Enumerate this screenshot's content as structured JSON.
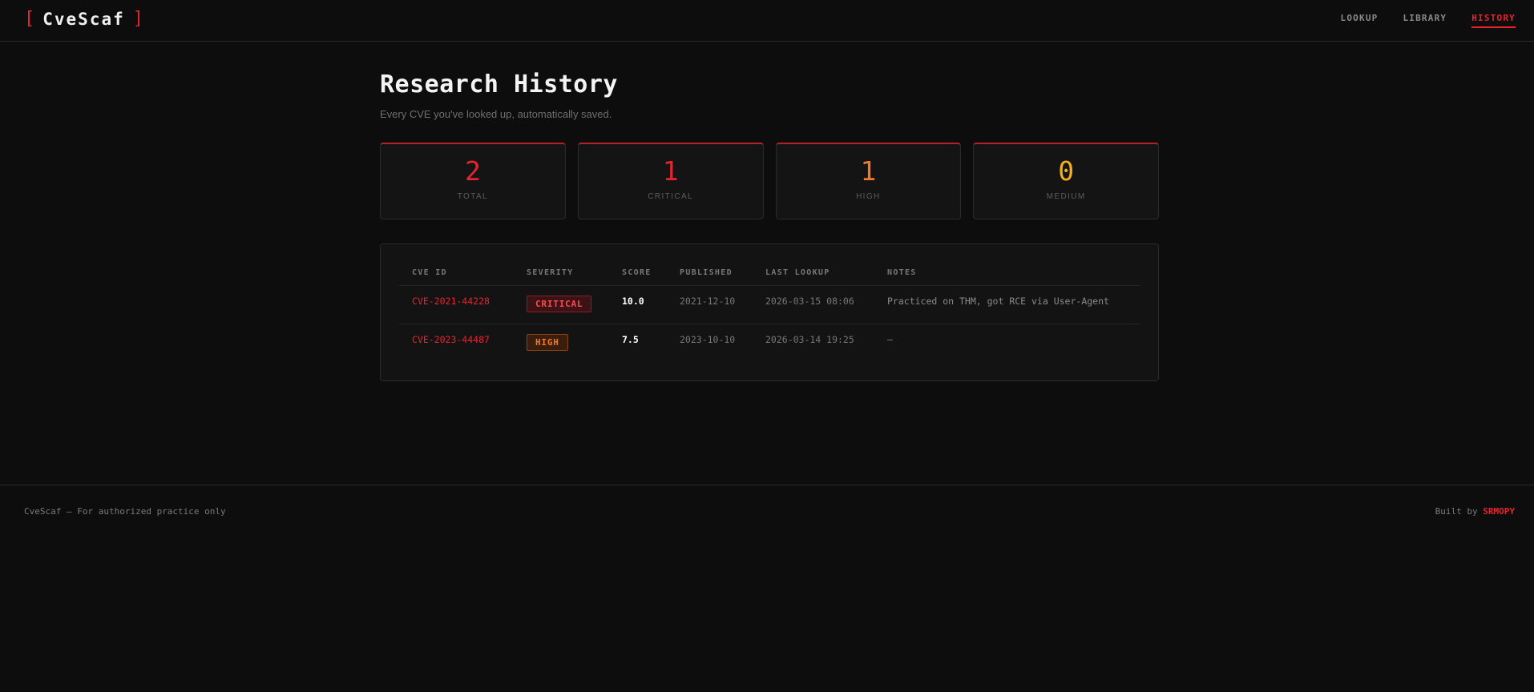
{
  "app": {
    "logo_open": "[",
    "logo_text": "CveScaf",
    "logo_close": "]"
  },
  "nav": {
    "lookup": "LOOKUP",
    "library": "LIBRARY",
    "history": "HISTORY",
    "active": "history"
  },
  "page": {
    "title": "Research History",
    "subtitle": "Every CVE you've looked up, automatically saved."
  },
  "stats": [
    {
      "value": "2",
      "label": "TOTAL",
      "color": "#e8232f"
    },
    {
      "value": "1",
      "label": "CRITICAL",
      "color": "#e8232f"
    },
    {
      "value": "1",
      "label": "HIGH",
      "color": "#f07a2a"
    },
    {
      "value": "0",
      "label": "MEDIUM",
      "color": "#f2b01e"
    }
  ],
  "table": {
    "headers": {
      "cve_id": "CVE ID",
      "severity": "SEVERITY",
      "score": "SCORE",
      "published": "PUBLISHED",
      "last_lookup": "LAST LOOKUP",
      "notes": "NOTES"
    },
    "rows": [
      {
        "cve_id": "CVE-2021-44228",
        "severity": "CRITICAL",
        "score": "10.0",
        "published": "2021-12-10",
        "last_lookup": "2026-03-15 08:06",
        "notes": "Practiced on THM, got RCE via User-Agent"
      },
      {
        "cve_id": "CVE-2023-44487",
        "severity": "HIGH",
        "score": "7.5",
        "published": "2023-10-10",
        "last_lookup": "2026-03-14 19:25",
        "notes": "—"
      }
    ]
  },
  "footer": {
    "left": "CveScaf — For authorized practice only",
    "built_by": "Built by",
    "author": "SRMOPY"
  },
  "colors": {
    "accent": "#e8232f",
    "high": "#f07a2a",
    "medium": "#f2b01e",
    "background": "#0d0d0d"
  }
}
